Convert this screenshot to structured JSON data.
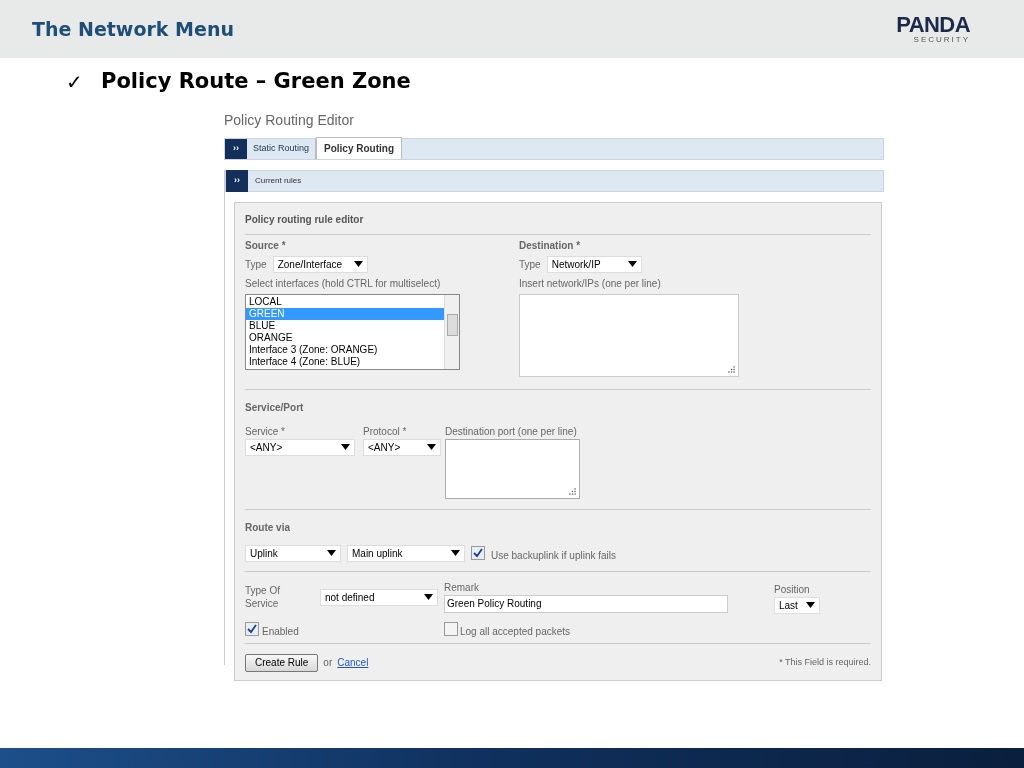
{
  "slide": {
    "title": "The Network Menu",
    "logo": {
      "main": "PANDA",
      "sub": "SECURITY"
    },
    "bullet": "✓",
    "heading": "Policy Route – Green Zone"
  },
  "editor": {
    "title": "Policy Routing Editor",
    "tabs": [
      {
        "label": "Static Routing",
        "selected": false
      },
      {
        "label": "Policy Routing",
        "selected": true
      }
    ],
    "section": {
      "marker": "››",
      "label": "Current rules"
    },
    "tab_marker": "››",
    "form_title": "Policy routing rule editor",
    "source": {
      "heading": "Source *",
      "type_label": "Type",
      "type_value": "Zone/Interface",
      "list_label": "Select interfaces (hold CTRL for multiselect)",
      "interfaces": [
        {
          "label": "LOCAL",
          "selected": false
        },
        {
          "label": "GREEN",
          "selected": true
        },
        {
          "label": "BLUE",
          "selected": false
        },
        {
          "label": "ORANGE",
          "selected": false
        },
        {
          "label": "Interface 3 (Zone: ORANGE)",
          "selected": false
        },
        {
          "label": "Interface 4 (Zone: BLUE)",
          "selected": false
        }
      ]
    },
    "destination": {
      "heading": "Destination *",
      "type_label": "Type",
      "type_value": "Network/IP",
      "list_label": "Insert network/IPs (one per line)"
    },
    "service": {
      "heading": "Service/Port",
      "service_label": "Service *",
      "service_value": "<ANY>",
      "protocol_label": "Protocol *",
      "protocol_value": "<ANY>",
      "port_label": "Destination port (one per line)"
    },
    "route": {
      "heading": "Route via",
      "via": "Uplink",
      "uplink": "Main uplink",
      "backup": {
        "label": "Use backuplink if uplink fails",
        "checked": true
      }
    },
    "tos": {
      "label": "Type Of Service",
      "value": "not defined"
    },
    "remark": {
      "label": "Remark",
      "value": "Green Policy Routing"
    },
    "position": {
      "label": "Position",
      "value": "Last"
    },
    "enabled": {
      "label": "Enabled",
      "checked": true
    },
    "log": {
      "label": "Log all accepted packets",
      "checked": false
    },
    "create_button": "Create Rule",
    "or": "or",
    "cancel": "Cancel",
    "required_note": "* This Field is required."
  }
}
